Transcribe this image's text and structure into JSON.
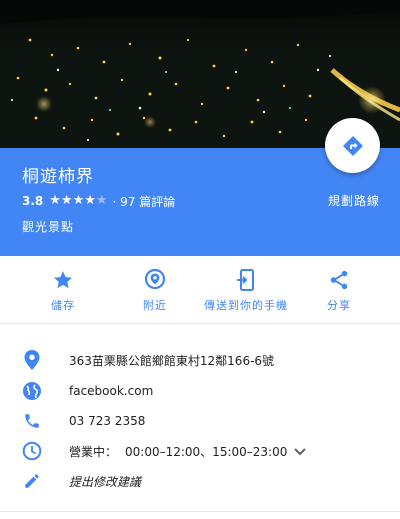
{
  "place": {
    "name": "桐遊柿界",
    "rating": "3.8",
    "stars_filled": 4,
    "stars_total": 5,
    "reviews": "· 97 篇評論",
    "category": "觀光景點",
    "route_label": "規劃路線"
  },
  "actions": [
    {
      "label": "儲存",
      "icon": "star-icon"
    },
    {
      "label": "附近",
      "icon": "nearby-pin-icon"
    },
    {
      "label": "傳送到你的手機",
      "icon": "send-to-phone-icon"
    },
    {
      "label": "分享",
      "icon": "share-icon"
    }
  ],
  "info": {
    "address": "363苗栗縣公館鄉館東村12鄰166-6號",
    "website": "facebook.com",
    "phone": "03 723 2358",
    "hours_status": "營業中：",
    "hours": "00:00–12:00、15:00–23:00",
    "suggest_edit": "提出修改建議"
  },
  "colors": {
    "accent": "#4285f4",
    "icon_blue": "#4285f4",
    "text": "#212121"
  }
}
